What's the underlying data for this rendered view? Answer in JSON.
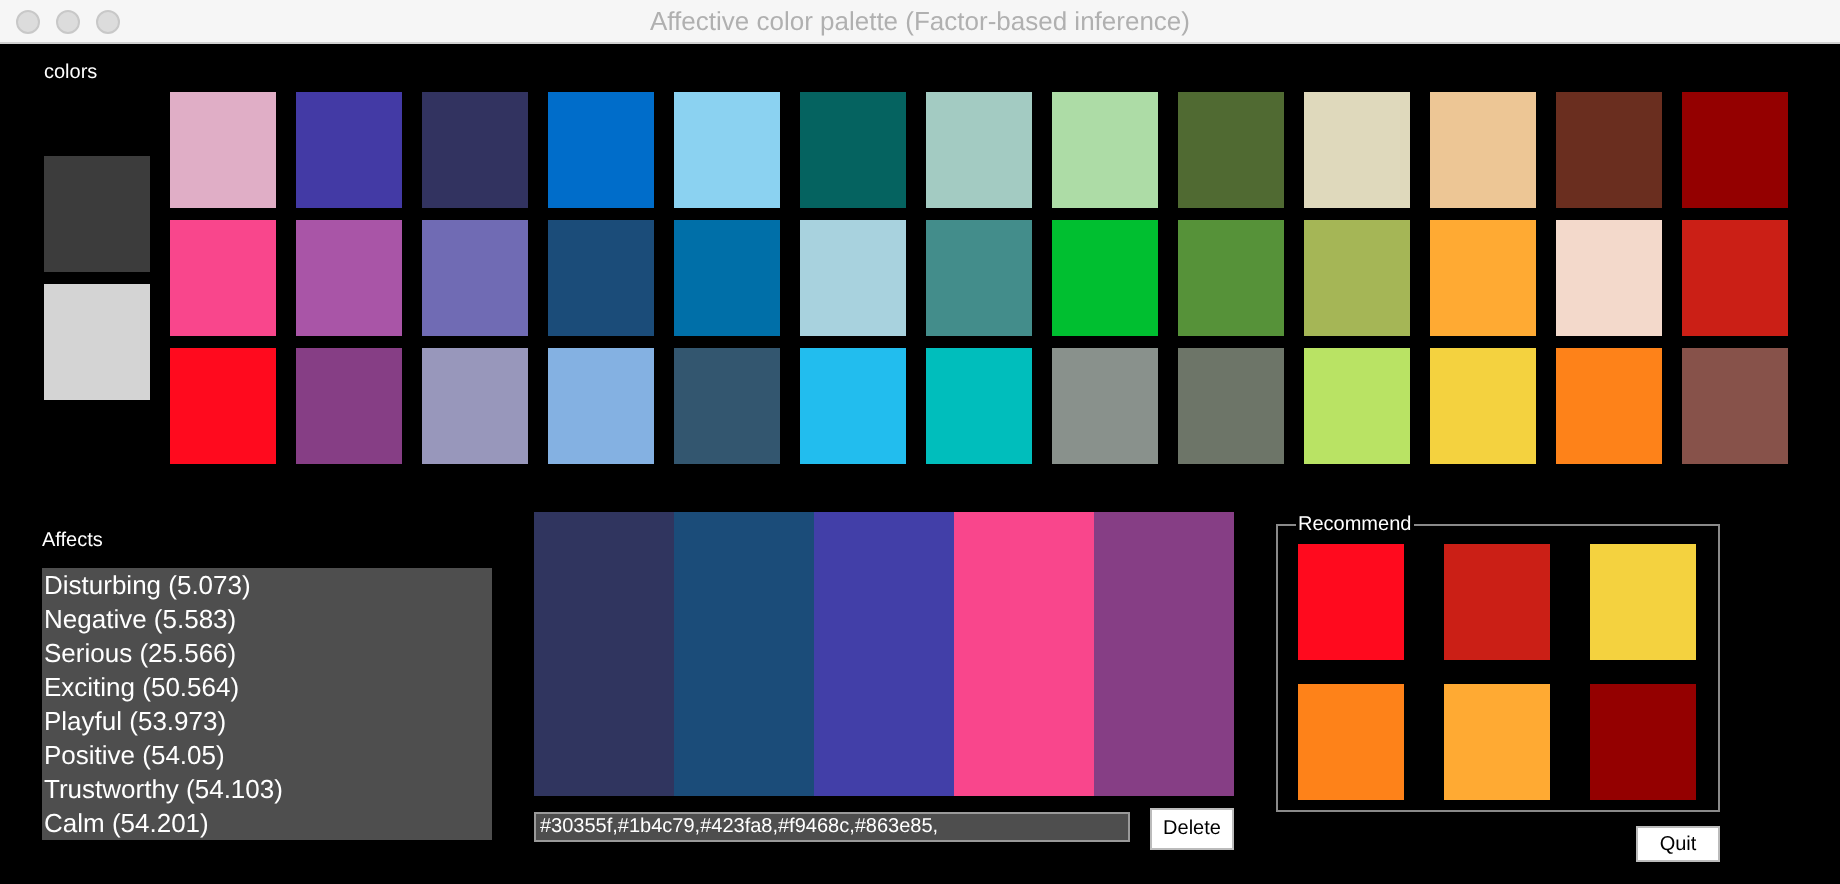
{
  "window": {
    "title": "Affective color palette (Factor-based inference)"
  },
  "colors": {
    "label": "colors",
    "side_swatches": [
      {
        "color": "#3c3c3c"
      },
      {
        "color": "#d4d4d4"
      }
    ],
    "grid": [
      {
        "color": "#e0aec6"
      },
      {
        "color": "#433aa5"
      },
      {
        "color": "#323360"
      },
      {
        "color": "#006dca"
      },
      {
        "color": "#8bd2f1"
      },
      {
        "color": "#056360"
      },
      {
        "color": "#a3cbc2"
      },
      {
        "color": "#addca6"
      },
      {
        "color": "#506a32"
      },
      {
        "color": "#dfd9bc"
      },
      {
        "color": "#edc695"
      },
      {
        "color": "#6a2e1f"
      },
      {
        "color": "#940000"
      },
      {
        "color": "#f9468c"
      },
      {
        "color": "#a955a7"
      },
      {
        "color": "#706bb4"
      },
      {
        "color": "#1b4c79"
      },
      {
        "color": "#006fa8"
      },
      {
        "color": "#a8d2de"
      },
      {
        "color": "#438d8b"
      },
      {
        "color": "#00bf30"
      },
      {
        "color": "#569239"
      },
      {
        "color": "#a5b656"
      },
      {
        "color": "#ffaa33"
      },
      {
        "color": "#f3d9cb"
      },
      {
        "color": "#cb1f16"
      },
      {
        "color": "#ff0a1e"
      },
      {
        "color": "#863e85"
      },
      {
        "color": "#9897bb"
      },
      {
        "color": "#84b1e2"
      },
      {
        "color": "#33566f"
      },
      {
        "color": "#22bdee"
      },
      {
        "color": "#00bebc"
      },
      {
        "color": "#89918c"
      },
      {
        "color": "#6d7568"
      },
      {
        "color": "#b9e364"
      },
      {
        "color": "#f4d23f"
      },
      {
        "color": "#fe8219"
      },
      {
        "color": "#87524a"
      }
    ]
  },
  "affects": {
    "label": "Affects",
    "items": [
      "Disturbing (5.073)",
      "Negative (5.583)",
      "Serious (25.566)",
      "Exciting (50.564)",
      "Playful (53.973)",
      "Positive (54.05)",
      "Trustworthy (54.103)",
      "Calm (54.201)"
    ]
  },
  "palette": {
    "stripes": [
      {
        "color": "#30355f"
      },
      {
        "color": "#1b4c79"
      },
      {
        "color": "#423fa8"
      },
      {
        "color": "#f9468c"
      },
      {
        "color": "#863e85"
      }
    ],
    "value": "#30355f,#1b4c79,#423fa8,#f9468c,#863e85,",
    "delete_button": "Delete"
  },
  "recommend": {
    "label": "Recommend",
    "swatches": [
      {
        "color": "#ff0a1e"
      },
      {
        "color": "#cb1f16"
      },
      {
        "color": "#f4d23f"
      },
      {
        "color": "#fe8219"
      },
      {
        "color": "#ffaa33"
      },
      {
        "color": "#940000"
      }
    ]
  },
  "quit_button": "Quit"
}
